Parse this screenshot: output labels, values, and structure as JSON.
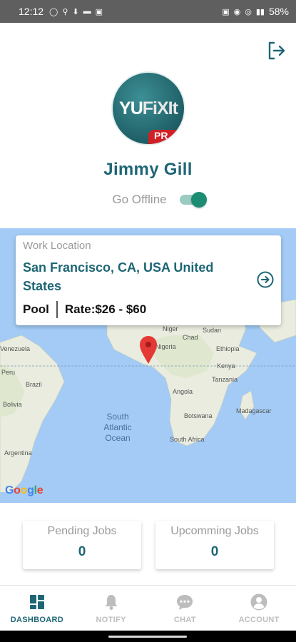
{
  "status_bar": {
    "time": "12:12",
    "battery": "58%"
  },
  "profile": {
    "avatar_brand_main": "YU",
    "avatar_brand_rest": "FiXIt",
    "avatar_badge": "PR",
    "name": "Jimmy Gill",
    "status_label": "Go Offline",
    "online": true
  },
  "work_card": {
    "label": "Work Location",
    "location": "San Francisco, CA, USA United States",
    "category": "Pool",
    "rate": "Rate:$26 - $60"
  },
  "map": {
    "labels": [
      "Niger",
      "Chad",
      "Sudan",
      "Nigeria",
      "Ethiopia",
      "Kenya",
      "Tanzania",
      "Angola",
      "Botswana",
      "South Africa",
      "Madagascar",
      "Brazil",
      "Bolivia",
      "Argentina",
      "Venezuela",
      "Peru",
      "South Atlantic Ocean",
      "Google"
    ],
    "water_color": "#a3cbf5",
    "land_color": "#e9ecde",
    "marker_color": "#e53935"
  },
  "stats": {
    "pending_label": "Pending Jobs",
    "pending_count": "0",
    "upcoming_label": "Upcomming Jobs",
    "upcoming_count": "0"
  },
  "nav": {
    "items": [
      {
        "label": "DASHBOARD",
        "icon": "dashboard-icon",
        "active": true
      },
      {
        "label": "NOTIFY",
        "icon": "bell-icon",
        "active": false
      },
      {
        "label": "CHAT",
        "icon": "chat-icon",
        "active": false
      },
      {
        "label": "ACCOUNT",
        "icon": "account-icon",
        "active": false
      }
    ]
  },
  "colors": {
    "primary": "#1e6675",
    "toggle": "#1b8d73",
    "brand_red": "#d21f26"
  }
}
